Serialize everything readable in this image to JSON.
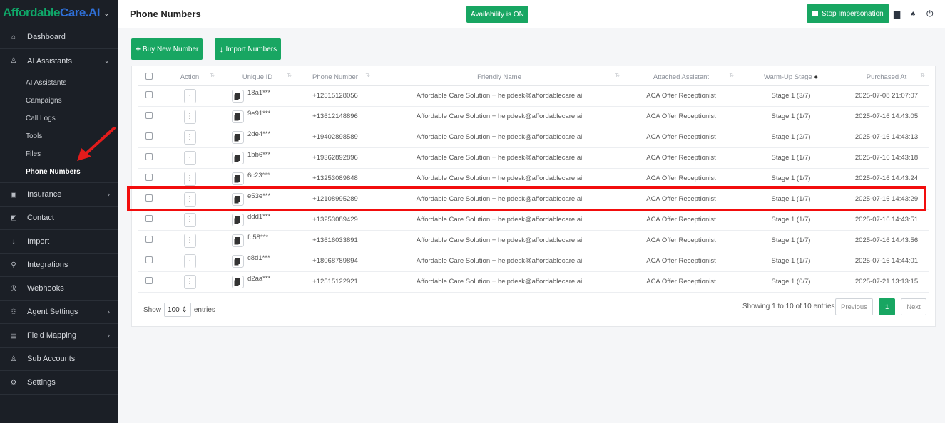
{
  "brand": {
    "logo_part1": "Affordable",
    "logo_part2": "Care.AI",
    "toggle": "⌄"
  },
  "sidebar": {
    "items": [
      {
        "label": "Dashboard",
        "icon": "home-icon"
      },
      {
        "label": "AI Assistants",
        "icon": "user-icon",
        "expanded": true
      },
      {
        "label": "Insurance",
        "icon": "card-icon"
      },
      {
        "label": "Contact",
        "icon": "contact-icon"
      },
      {
        "label": "Import",
        "icon": "import-icon"
      },
      {
        "label": "Integrations",
        "icon": "plug-icon"
      },
      {
        "label": "Webhooks",
        "icon": "webhook-icon"
      },
      {
        "label": "Agent Settings",
        "icon": "users-icon"
      },
      {
        "label": "Field Mapping",
        "icon": "database-icon"
      },
      {
        "label": "Sub Accounts",
        "icon": "user-icon"
      },
      {
        "label": "Settings",
        "icon": "gear-icon"
      }
    ],
    "sub_items": [
      "AI Assistants",
      "Campaigns",
      "Call Logs",
      "Tools",
      "Files",
      "Phone Numbers"
    ],
    "active_sub": "Phone Numbers"
  },
  "header": {
    "title": "Phone Numbers",
    "availability": "Availability is ON",
    "stop_impersonation": "Stop Impersonation"
  },
  "toolbar": {
    "buy_label": "Buy New Number",
    "import_label": "Import Numbers"
  },
  "table": {
    "columns": [
      "",
      "Action",
      "Unique ID",
      "Phone Number",
      "Friendly Name",
      "Attached Assistant",
      "Warm-Up Stage",
      "Purchased At"
    ],
    "rows": [
      {
        "uid": "18a1***",
        "phone": "+12515128056",
        "friendly": "Affordable Care Solution + helpdesk@affordablecare.ai",
        "assistant": "ACA Offer Receptionist",
        "stage": "Stage 1 (3/7)",
        "purchased": "2025-07-08 21:07:07"
      },
      {
        "uid": "9e91***",
        "phone": "+13612148896",
        "friendly": "Affordable Care Solution + helpdesk@affordablecare.ai",
        "assistant": "ACA Offer Receptionist",
        "stage": "Stage 1 (1/7)",
        "purchased": "2025-07-16 14:43:05"
      },
      {
        "uid": "2de4***",
        "phone": "+19402898589",
        "friendly": "Affordable Care Solution + helpdesk@affordablecare.ai",
        "assistant": "ACA Offer Receptionist",
        "stage": "Stage 1 (2/7)",
        "purchased": "2025-07-16 14:43:13"
      },
      {
        "uid": "1bb6***",
        "phone": "+19362892896",
        "friendly": "Affordable Care Solution + helpdesk@affordablecare.ai",
        "assistant": "ACA Offer Receptionist",
        "stage": "Stage 1 (1/7)",
        "purchased": "2025-07-16 14:43:18"
      },
      {
        "uid": "6c23***",
        "phone": "+13253089848",
        "friendly": "Affordable Care Solution + helpdesk@affordablecare.ai",
        "assistant": "ACA Offer Receptionist",
        "stage": "Stage 1 (1/7)",
        "purchased": "2025-07-16 14:43:24"
      },
      {
        "uid": "e53e***",
        "phone": "+12108995289",
        "friendly": "Affordable Care Solution + helpdesk@affordablecare.ai",
        "assistant": "ACA Offer Receptionist",
        "stage": "Stage 1 (1/7)",
        "purchased": "2025-07-16 14:43:29"
      },
      {
        "uid": "ddd1***",
        "phone": "+13253089429",
        "friendly": "Affordable Care Solution + helpdesk@affordablecare.ai",
        "assistant": "ACA Offer Receptionist",
        "stage": "Stage 1 (1/7)",
        "purchased": "2025-07-16 14:43:51"
      },
      {
        "uid": "fc58***",
        "phone": "+13616033891",
        "friendly": "Affordable Care Solution + helpdesk@affordablecare.ai",
        "assistant": "ACA Offer Receptionist",
        "stage": "Stage 1 (1/7)",
        "purchased": "2025-07-16 14:43:56"
      },
      {
        "uid": "c8d1***",
        "phone": "+18068789894",
        "friendly": "Affordable Care Solution + helpdesk@affordablecare.ai",
        "assistant": "ACA Offer Receptionist",
        "stage": "Stage 1 (1/7)",
        "purchased": "2025-07-16 14:44:01"
      },
      {
        "uid": "d2aa***",
        "phone": "+12515122921",
        "friendly": "Affordable Care Solution + helpdesk@affordablecare.ai",
        "assistant": "ACA Offer Receptionist",
        "stage": "Stage 1 (0/7)",
        "purchased": "2025-07-21 13:13:15"
      }
    ]
  },
  "footer": {
    "show_label": "Show",
    "page_size": "100",
    "entries_label": "entries",
    "info": "Showing 1 to 10 of 10 entries",
    "previous": "Previous",
    "current_page": "1",
    "next": "Next"
  },
  "colors": {
    "accent": "#18a662",
    "sidebar_bg": "#1b1f26",
    "highlight": "#f20d0d"
  }
}
